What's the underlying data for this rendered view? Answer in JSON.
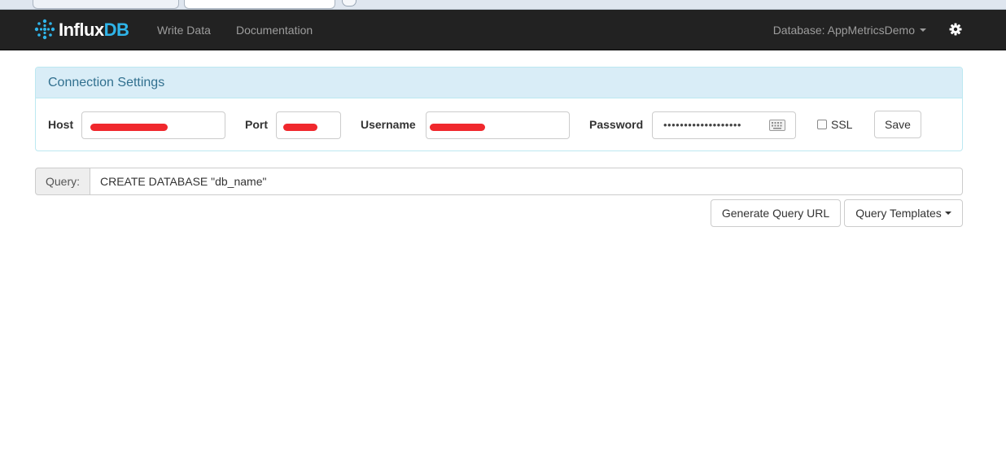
{
  "colors": {
    "navbar_bg": "#222222",
    "brand_accent": "#2fb5ea",
    "panel_heading_bg": "#d9edf7",
    "panel_heading_text": "#31708f",
    "redaction": "#f0282d"
  },
  "navbar": {
    "brand_part1": "Influx",
    "brand_part2": "DB",
    "brand_icon": "influxdb-logo-icon",
    "links": [
      {
        "label": "Write Data"
      },
      {
        "label": "Documentation"
      }
    ],
    "database_label": "Database: AppMetricsDemo",
    "database_dropdown_icon": "caret-down-icon",
    "settings_icon": "gear-icon"
  },
  "connection": {
    "title": "Connection Settings",
    "host_label": "Host",
    "port_label": "Port",
    "username_label": "Username",
    "password_label": "Password",
    "password_value": "•••••••••••••••••••",
    "password_icon": "keyboard-icon",
    "ssl_label": "SSL",
    "ssl_checked": false,
    "save_label": "Save"
  },
  "query": {
    "addon_label": "Query:",
    "value": "CREATE DATABASE \"db_name\"",
    "generate_url_label": "Generate Query URL",
    "templates_label": "Query Templates"
  }
}
